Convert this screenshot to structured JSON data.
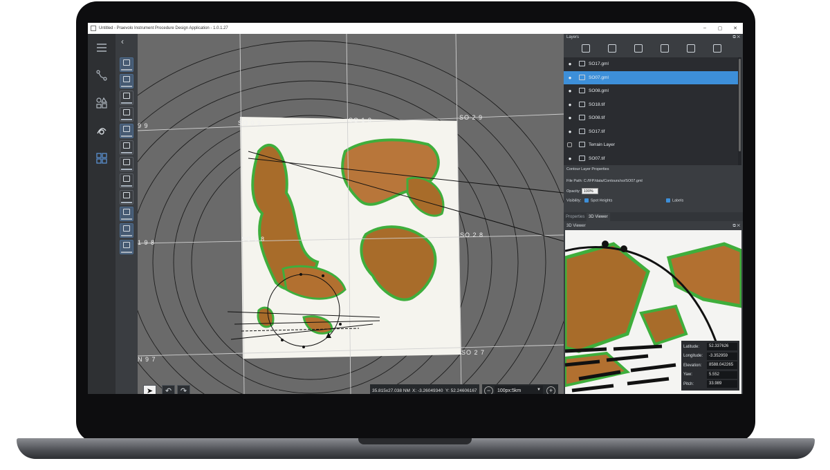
{
  "window": {
    "title": "Untitled - Praevolo Instrument Procedure Design Application - 1.0.1.27",
    "controls": [
      "–",
      "▢",
      "✕"
    ]
  },
  "rail": {
    "icons": [
      "menu-icon",
      "route-icon",
      "shapes-icon",
      "procedure-icon",
      "grid-apps-icon"
    ]
  },
  "tools": {
    "back_label": "‹"
  },
  "map": {
    "grid_labels": [
      "SO 0 9",
      "SO 1 9",
      "SO 2 9",
      "9 9",
      "1 9 8",
      "SO 0 8",
      "SO 2 8",
      "SO 2 7",
      "N 9 7"
    ],
    "scale_readout": "35.815x27.038 NM",
    "x_readout": "X: -3.26049340",
    "y_readout": "Y: 52.24606167",
    "zoom_value": "100px:5km",
    "zoom_out": "−",
    "zoom_in": "+",
    "undo": "↶",
    "redo": "↷",
    "pointer": "➤"
  },
  "layers_panel": {
    "title": "Layers",
    "buttons": "⧉ ✕",
    "items": [
      {
        "name": "SO17.gml",
        "visible": true,
        "selected": false
      },
      {
        "name": "SO07.gml",
        "visible": true,
        "selected": true
      },
      {
        "name": "SO08.gml",
        "visible": true,
        "selected": false
      },
      {
        "name": "SO18.tif",
        "visible": true,
        "selected": false
      },
      {
        "name": "SO08.tif",
        "visible": true,
        "selected": false
      },
      {
        "name": "SO17.tif",
        "visible": true,
        "selected": false
      },
      {
        "name": "Terrain Layer",
        "visible": false,
        "selected": false
      },
      {
        "name": "SO07.tif",
        "visible": true,
        "selected": false
      }
    ]
  },
  "layer_props": {
    "title": "Contour Layer Properties",
    "file_path_label": "File Path:",
    "file_path": "C:/IFP/data/Contours/so/SO07.gml",
    "opacity_label": "Opacity:",
    "opacity_value": "100%",
    "visibility_label": "Visibility:",
    "spot_heights_label": "Spot Heights",
    "labels_label": "Labels"
  },
  "tabs": [
    "Properties",
    "3D Viewer"
  ],
  "viewer": {
    "title": "3D Viewer",
    "buttons": "⧉ ✕",
    "latitude_label": "Latitude:",
    "latitude": "52.337626",
    "longitude_label": "Longitude:",
    "longitude": "-3.352959",
    "elevation_label": "Elevation:",
    "elevation": "8588.042265",
    "yaw_label": "Yaw:",
    "yaw": "5.552",
    "pitch_label": "Pitch:",
    "pitch": "33.989"
  },
  "colors": {
    "accent": "#3d8fd9",
    "panel": "#3a3d41",
    "terrain_brown": "#a86c2a",
    "terrain_green": "#3fae3c"
  }
}
